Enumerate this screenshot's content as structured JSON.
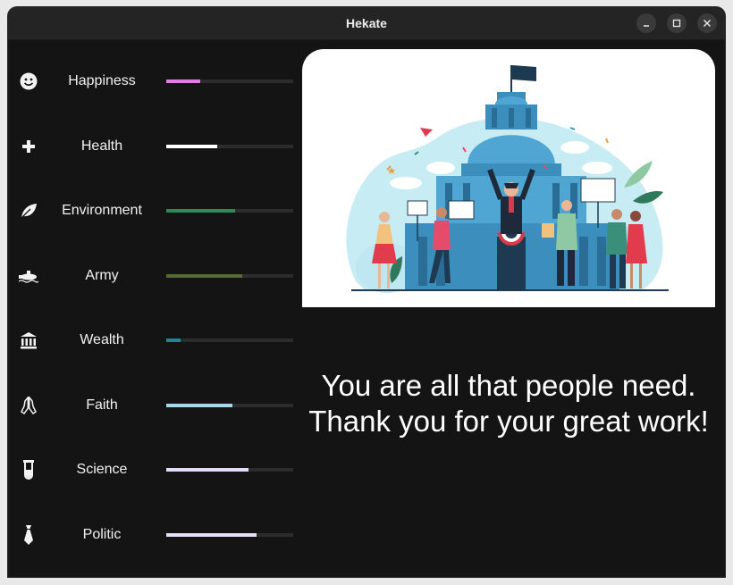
{
  "window": {
    "title": "Hekate"
  },
  "stats": [
    {
      "label": "Happiness",
      "icon": "smiley-icon",
      "level": 0.27,
      "color": "#e879e8"
    },
    {
      "label": "Health",
      "icon": "plus-cross-icon",
      "level": 0.4,
      "color": "#ffffff"
    },
    {
      "label": "Environment",
      "icon": "leaf-icon",
      "level": 0.54,
      "color": "#2e8b57"
    },
    {
      "label": "Army",
      "icon": "submarine-icon",
      "level": 0.6,
      "color": "#556b2f"
    },
    {
      "label": "Wealth",
      "icon": "bank-icon",
      "level": 0.11,
      "color": "#1a8a99"
    },
    {
      "label": "Faith",
      "icon": "praying-hands-icon",
      "level": 0.52,
      "color": "#a6d8e8"
    },
    {
      "label": "Science",
      "icon": "test-tube-icon",
      "level": 0.65,
      "color": "#e4dcf8"
    },
    {
      "label": "Politic",
      "icon": "tie-icon",
      "level": 0.71,
      "color": "#e8e0f8"
    }
  ],
  "message": {
    "line1": "You are all that people need.",
    "line2": "Thank you for your great work!"
  }
}
